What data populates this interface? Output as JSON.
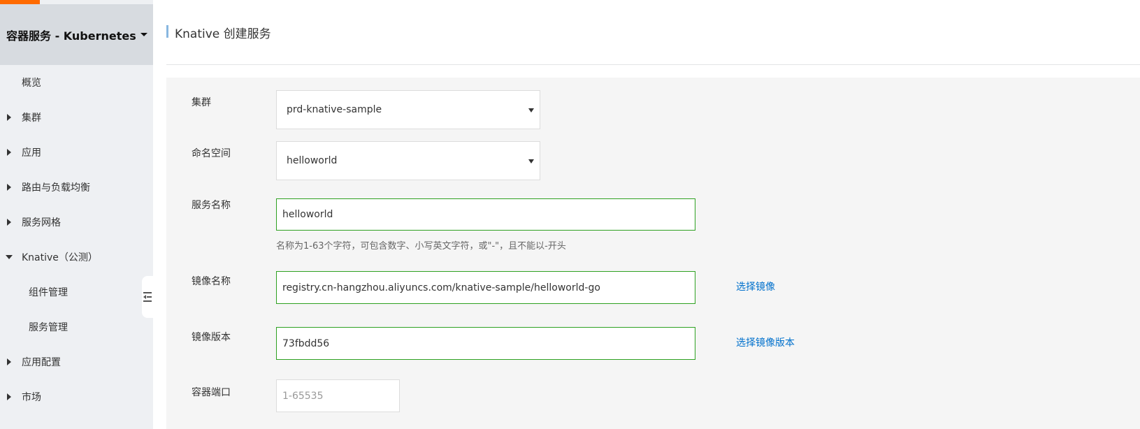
{
  "sidebar": {
    "title": "容器服务 - Kubernetes",
    "items": [
      {
        "label": "概览",
        "indicator": "none"
      },
      {
        "label": "集群",
        "indicator": "collapsed"
      },
      {
        "label": "应用",
        "indicator": "collapsed"
      },
      {
        "label": "路由与负载均衡",
        "indicator": "collapsed"
      },
      {
        "label": "服务网格",
        "indicator": "collapsed"
      },
      {
        "label": "Knative（公测）",
        "indicator": "expanded"
      },
      {
        "label": "组件管理",
        "indicator": "sub"
      },
      {
        "label": "服务管理",
        "indicator": "sub"
      },
      {
        "label": "应用配置",
        "indicator": "collapsed"
      },
      {
        "label": "市场",
        "indicator": "collapsed"
      }
    ]
  },
  "header": {
    "title": "Knative 创建服务"
  },
  "form": {
    "cluster": {
      "label": "集群",
      "value": "prd-knative-sample"
    },
    "namespace": {
      "label": "命名空间",
      "value": "helloworld"
    },
    "service_name": {
      "label": "服务名称",
      "value": "helloworld",
      "hint": "名称为1-63个字符，可包含数字、小写英文字符，或\"-\"，且不能以-开头"
    },
    "image_name": {
      "label": "镜像名称",
      "value": "registry.cn-hangzhou.aliyuncs.com/knative-sample/helloworld-go",
      "link": "选择镜像"
    },
    "image_version": {
      "label": "镜像版本",
      "value": "73fbdd56",
      "link": "选择镜像版本"
    },
    "container_port": {
      "label": "容器端口",
      "placeholder": "1-65535"
    }
  },
  "colors": {
    "accent": "#ff6a00",
    "link": "#0070cc",
    "valid_border": "#2ea121",
    "sidebar_bg": "#eef0f3",
    "sidebar_header_bg": "#d7dbe0"
  }
}
